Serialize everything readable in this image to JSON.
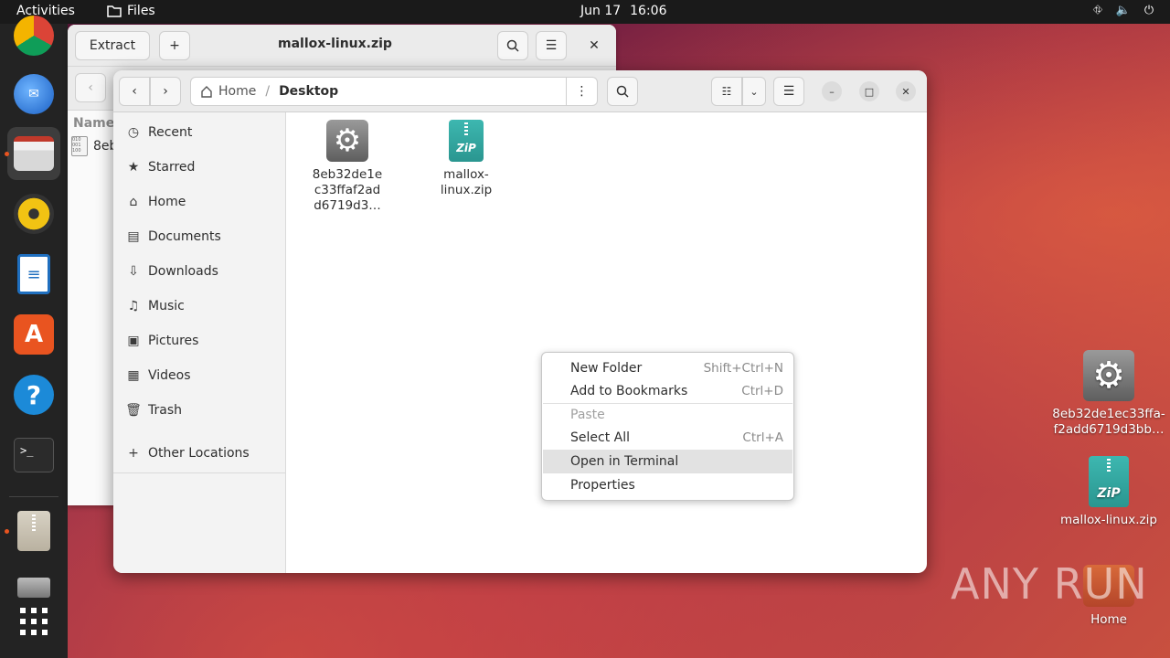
{
  "topbar": {
    "activities": "Activities",
    "app_name": "Files",
    "date": "Jun 17",
    "time": "16:06"
  },
  "archive_window": {
    "extract_label": "Extract",
    "add_label": "+",
    "title": "mallox-linux.zip",
    "column_name": "Name",
    "row_file": "8eb"
  },
  "files_window": {
    "path_home": "Home",
    "path_separator": "/",
    "path_current": "Desktop",
    "sidebar": [
      {
        "label": "Recent",
        "icon": "clock-icon"
      },
      {
        "label": "Starred",
        "icon": "star-icon"
      },
      {
        "label": "Home",
        "icon": "home-icon"
      },
      {
        "label": "Documents",
        "icon": "document-icon"
      },
      {
        "label": "Downloads",
        "icon": "download-icon"
      },
      {
        "label": "Music",
        "icon": "music-icon"
      },
      {
        "label": "Pictures",
        "icon": "pictures-icon"
      },
      {
        "label": "Videos",
        "icon": "videos-icon"
      },
      {
        "label": "Trash",
        "icon": "trash-icon"
      },
      {
        "label": "Other Locations",
        "icon": "plus-icon"
      }
    ],
    "files": [
      {
        "name_line1": "8eb32de1e",
        "name_line2": "c33ffaf2ad",
        "name_line3": "d6719d3…",
        "type": "executable"
      },
      {
        "name_line1": "mallox-",
        "name_line2": "linux.zip",
        "name_line3": "",
        "type": "zip"
      }
    ]
  },
  "context_menu": {
    "items": [
      {
        "label": "New Folder",
        "accel": "Shift+Ctrl+N",
        "disabled": false
      },
      {
        "label": "Add to Bookmarks",
        "accel": "Ctrl+D",
        "disabled": false
      },
      {
        "label": "Paste",
        "accel": "",
        "disabled": true
      },
      {
        "label": "Select All",
        "accel": "Ctrl+A",
        "disabled": false
      },
      {
        "label": "Open in Terminal",
        "accel": "",
        "disabled": false,
        "highlighted": true
      },
      {
        "label": "Properties",
        "accel": "",
        "disabled": false
      }
    ]
  },
  "desktop": {
    "icons": [
      {
        "label_line1": "8eb32de1ec33ffa-",
        "label_line2": "f2add6719d3bb…"
      },
      {
        "label_line1": "mallox-linux.zip",
        "label_line2": ""
      },
      {
        "label_line1": "Home",
        "label_line2": ""
      }
    ],
    "watermark": "ANY RUN"
  },
  "colors": {
    "accent": "#e95420",
    "zip": "#2fa39c"
  }
}
